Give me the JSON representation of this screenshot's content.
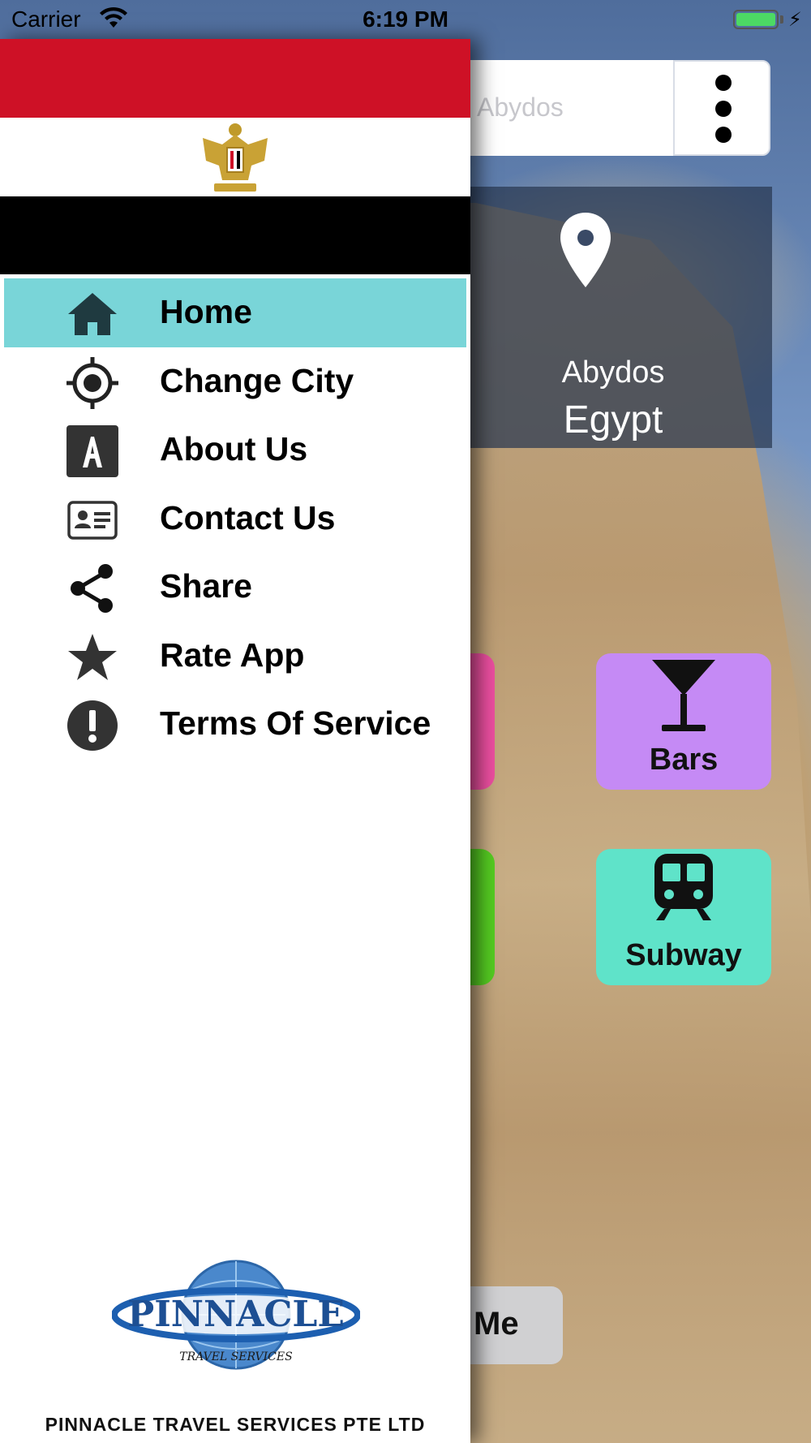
{
  "status_bar": {
    "carrier": "Carrier",
    "time": "6:19 PM",
    "battery_color": "#4cd964"
  },
  "background_app": {
    "search": {
      "value": "Abydos"
    },
    "location": {
      "city": "Abydos",
      "country": "Egypt",
      "icon": "map-pin-icon"
    },
    "tiles": [
      {
        "label": "Bars",
        "icon": "cocktail-icon",
        "color": "#c58af5"
      },
      {
        "label": "Subway",
        "icon": "subway-train-icon",
        "color": "#5fe3c9"
      }
    ],
    "near_me_partial_label": "Me"
  },
  "drawer": {
    "header_image": "egypt-flag",
    "menu": [
      {
        "label": "Home",
        "icon": "home-icon",
        "active": true
      },
      {
        "label": "Change City",
        "icon": "target-icon"
      },
      {
        "label": "About Us",
        "icon": "letter-a-icon"
      },
      {
        "label": "Contact Us",
        "icon": "contact-card-icon"
      },
      {
        "label": "Share",
        "icon": "share-icon"
      },
      {
        "label": "Rate App",
        "icon": "star-icon"
      },
      {
        "label": "Terms Of Service",
        "icon": "exclamation-icon"
      }
    ],
    "logo": {
      "text": "PINNACLE",
      "subtext": "TRAVEL SERVICES"
    },
    "footer": "PINNACLE TRAVEL SERVICES PTE LTD",
    "active_color": "#79d5d8"
  }
}
